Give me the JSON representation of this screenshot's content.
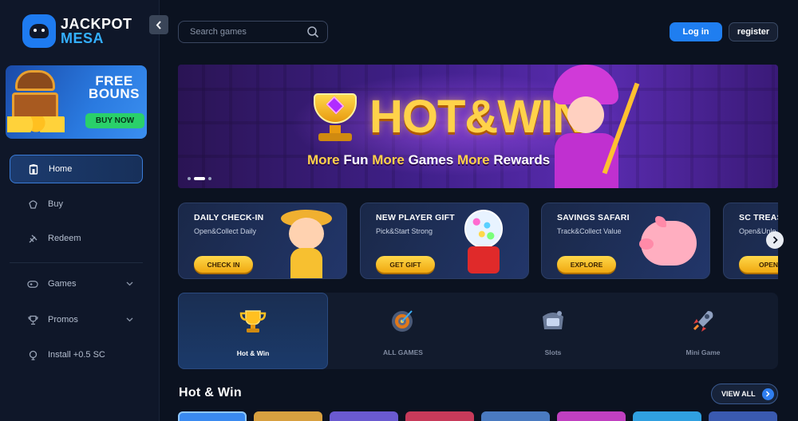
{
  "brand": {
    "line1": "JACKPOT",
    "line2": "MESA"
  },
  "promo": {
    "title_line1": "FREE",
    "title_line2": "BOUNS",
    "button": "BUY NOW"
  },
  "sidebar": {
    "items": [
      {
        "label": "Home",
        "icon": "home-icon"
      },
      {
        "label": "Buy",
        "icon": "buy-icon"
      },
      {
        "label": "Redeem",
        "icon": "redeem-icon"
      },
      {
        "label": "Games",
        "icon": "gamepad-icon"
      },
      {
        "label": "Promos",
        "icon": "trophy-icon"
      },
      {
        "label": "Install +0.5 SC",
        "icon": "install-icon"
      }
    ]
  },
  "header": {
    "search_placeholder": "Search games",
    "login": "Log in",
    "register": "register"
  },
  "hero": {
    "title": "HOT&WIN",
    "sub_w1": "More",
    "sub_w2": " Fun ",
    "sub_w3": "More",
    "sub_w4": " Games ",
    "sub_w5": "More",
    "sub_w6": " Rewards"
  },
  "cards": [
    {
      "title": "DAILY CHECK-IN",
      "subtitle": "Open&Collect Daily",
      "button": "CHECK IN"
    },
    {
      "title": "NEW PLAYER GIFT",
      "subtitle": "Pick&Start Strong",
      "button": "GET GIFT"
    },
    {
      "title": "SAVINGS SAFARI",
      "subtitle": "Track&Collect Value",
      "button": "EXPLORE"
    },
    {
      "title": "SC TREASUR",
      "subtitle": "Open&Unlo",
      "button": "OPEN"
    }
  ],
  "categories": [
    {
      "label": "Hot & Win",
      "icon": "trophy-icon"
    },
    {
      "label": "ALL GAMES",
      "icon": "dartboard-icon"
    },
    {
      "label": "Slots",
      "icon": "slots-icon"
    },
    {
      "label": "Mini Game",
      "icon": "rocket-icon"
    }
  ],
  "section": {
    "title": "Hot & Win",
    "view_all": "VIEW ALL"
  },
  "colors": {
    "accent": "#1f7ef0",
    "bg": "#0b1220",
    "gold": "#ffd24a",
    "green": "#2ad06a"
  }
}
